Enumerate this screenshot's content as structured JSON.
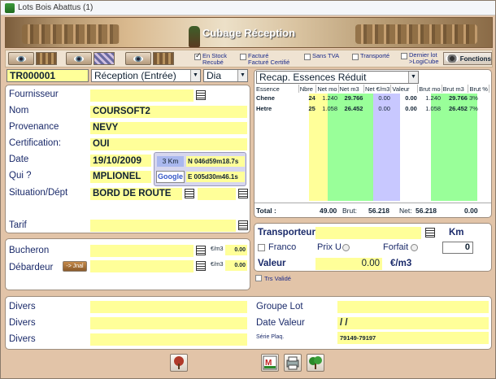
{
  "window": {
    "title": "Lots Bois Abattus (1)"
  },
  "banner": {
    "title": "Cubage Réception"
  },
  "toolbar": {
    "checks": [
      {
        "line1": "En Stock",
        "line2": "Recubé",
        "checked": true
      },
      {
        "line1": "Facturé",
        "line2": "Facturé Certifié",
        "checked": false
      },
      {
        "line1": "Sans TVA",
        "line2": "",
        "checked": false
      },
      {
        "line1": "Transporté",
        "line2": "",
        "checked": false
      },
      {
        "line1": "Dernier lot",
        "line2": ">LogiCube",
        "checked": false
      }
    ],
    "fonctions_label": "Fonctions"
  },
  "header": {
    "lot_number": "TR000001",
    "reception_type": "Réception (Entrée)",
    "unit": "Dia"
  },
  "form": {
    "fournisseur_label": "Fournisseur",
    "fournisseur": "",
    "nom_label": "Nom",
    "nom": "COURSOFT2",
    "provenance_label": "Provenance",
    "provenance": "NEVY",
    "certification_label": "Certification:",
    "certification": "OUI",
    "date_label": "Date",
    "date": "19/10/2009",
    "distance": "3 Km",
    "coord_n": "N 046d59m18.7s",
    "qui_label": "Qui ?",
    "qui": "MPLIONEL",
    "google_label": "Google",
    "coord_e": "E 005d30m46.1s",
    "situation_label": "Situation/Dépt",
    "situation": "BORD DE ROUTE",
    "situation_dept": "",
    "tarif_label": "Tarif",
    "tarif": ""
  },
  "workers": {
    "bucheron_label": "Bucheron",
    "bucheron": "",
    "bucheron_unit": "€/m3",
    "bucheron_price": "0.00",
    "debardeur_label": "Débardeur",
    "jnal_label": "-> Jnal",
    "debardeur": "",
    "debardeur_unit": "€/m3",
    "debardeur_price": "0.00"
  },
  "recap": {
    "dropdown": "Recap. Essences Réduit",
    "columns": [
      "Essence",
      "Nbre",
      "Net mo",
      "Net m3",
      "Net €/m3",
      "Valeur",
      "Brut mo",
      "Brut m3",
      "Brut %"
    ],
    "rows": [
      {
        "essence": "Chene",
        "nbre": "24",
        "net_mo": "1.240",
        "net_m3": "29.766",
        "net_eur": "0.00",
        "valeur": "0.00",
        "brut_mo": "1.240",
        "brut_m3": "29.766",
        "brut_pct": "3%"
      },
      {
        "essence": "Hetre",
        "nbre": "25",
        "net_mo": "1.058",
        "net_m3": "26.452",
        "net_eur": "0.00",
        "valeur": "0.00",
        "brut_mo": "1.058",
        "brut_m3": "26.452",
        "brut_pct": "7%"
      }
    ],
    "total_label": "Total :",
    "total_nbre": "49.00",
    "brut_label": "Brut:",
    "brut_total": "56.218",
    "net_label": "Net:",
    "net_total": "56.218",
    "total_valeur": "0.00"
  },
  "transport": {
    "transporteur_label": "Transporteur",
    "transporteur": "",
    "km_label": "Km",
    "franco_label": "Franco",
    "prixu_label": "Prix U",
    "forfait_label": "Forfait",
    "km_value": "0",
    "valeur_label": "Valeur",
    "valeur": "0.00",
    "valeur_unit": "€/m3",
    "trs_valide_label": "Trs Validé"
  },
  "bottom": {
    "divers1_label": "Divers",
    "divers1": "",
    "divers2_label": "Divers",
    "divers2": "",
    "divers3_label": "Divers",
    "divers3": "",
    "groupe_label": "Groupe Lot",
    "groupe": "",
    "date_valeur_label": "Date Valeur",
    "date_valeur": "/ /",
    "serie_label": "Série Plaq.",
    "serie": "79149-79197"
  },
  "colors": {
    "yellow": "#ffff99",
    "green": "#99ff99",
    "purple": "#c8c8ff",
    "label": "#1a2a6a"
  }
}
